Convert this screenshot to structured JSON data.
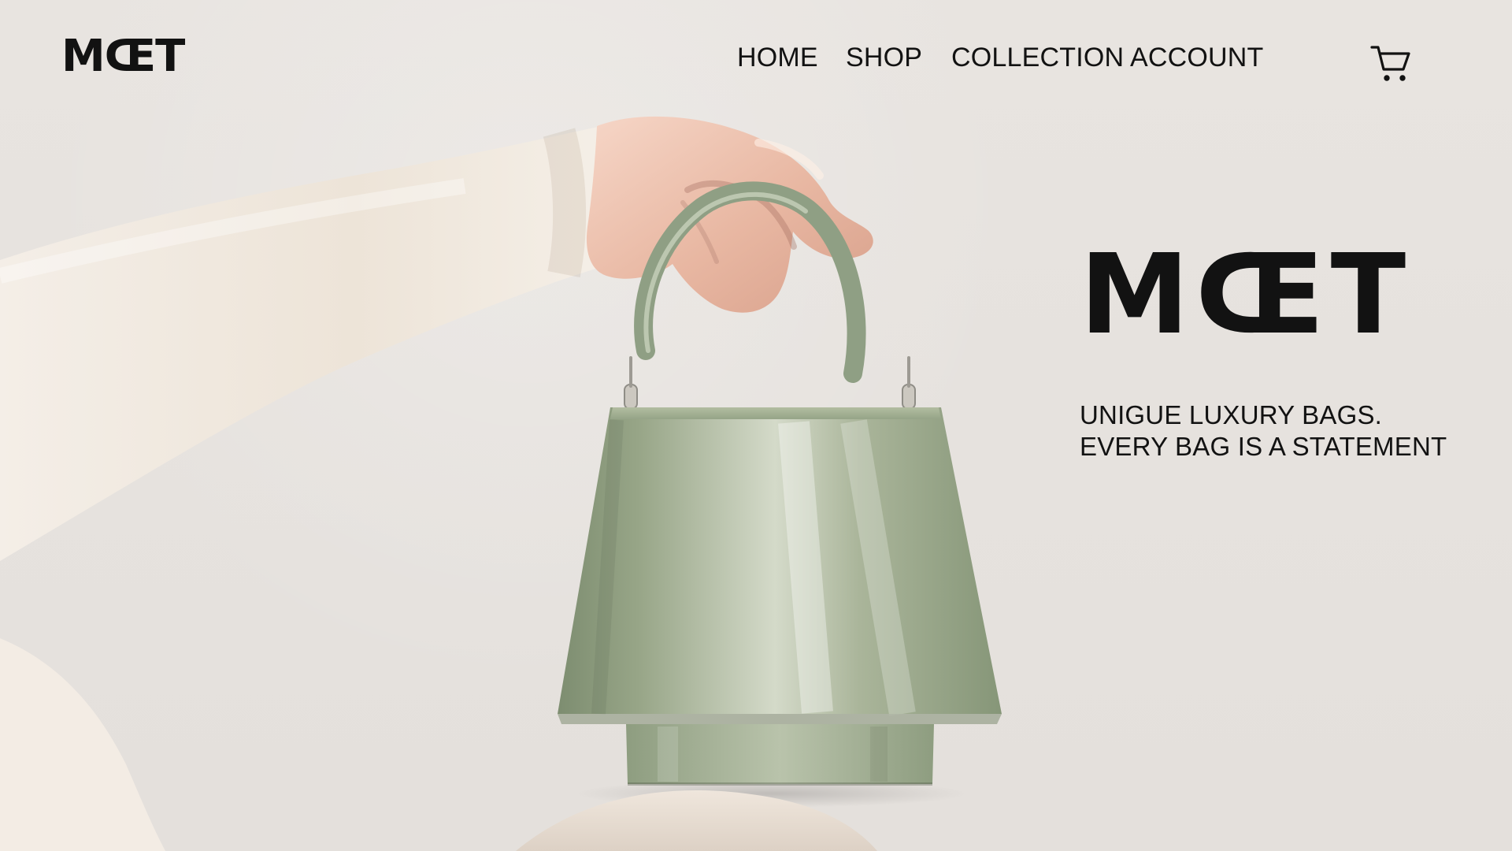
{
  "brand": {
    "logo": "MŒT",
    "hero_title": "MŒT"
  },
  "navigation": {
    "items": [
      {
        "label": "HOME"
      },
      {
        "label": "SHOP"
      },
      {
        "label": "COLLECTION"
      },
      {
        "label": "ACCOUNT"
      }
    ]
  },
  "header": {
    "cart_icon": "cart-icon"
  },
  "hero": {
    "tagline_lines": [
      "UNIGUE LUXURY BAGS.",
      "EVERY BAG IS A STATEMENT"
    ]
  },
  "colors": {
    "background": "#e7e3df",
    "text": "#121212",
    "bag_green": "#9aa98a",
    "sweater_cream": "#f0e8de"
  }
}
